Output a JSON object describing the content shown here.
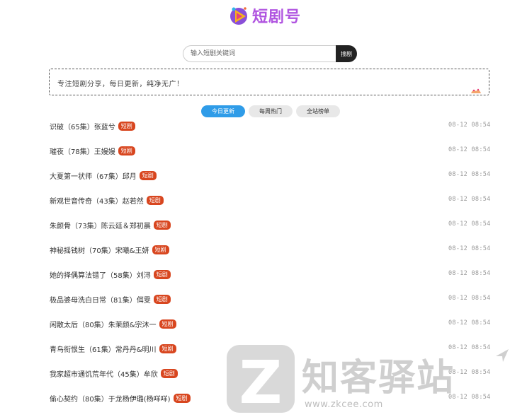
{
  "logo": {
    "text": "短剧号"
  },
  "search": {
    "placeholder": "输入短剧关键词",
    "button_label": "搜剧"
  },
  "notice": {
    "text": "专注短剧分享，每日更新，纯净无广！"
  },
  "tabs": [
    {
      "label": "今日更新",
      "active": true
    },
    {
      "label": "每周热门",
      "active": false
    },
    {
      "label": "全站榜单",
      "active": false
    }
  ],
  "items": [
    {
      "title": "识破（65集）张蓝兮",
      "badge": "短剧",
      "time": "08-12 08:54"
    },
    {
      "title": "璀夜（78集）王嫚嫚",
      "badge": "短剧",
      "time": "08-12 08:54"
    },
    {
      "title": "大夏第一状师（67集）邱月",
      "badge": "短剧",
      "time": "08-12 08:54"
    },
    {
      "title": "新观世音传奇（43集）赵若然",
      "badge": "短剧",
      "time": "08-12 08:54"
    },
    {
      "title": "朱颜骨（73集）陈云廷＆郑初晨",
      "badge": "短剧",
      "time": "08-12 08:54"
    },
    {
      "title": "神秘摇钱树（70集）宋曦&王妍",
      "badge": "短剧",
      "time": "08-12 08:54"
    },
    {
      "title": "她的择偶算法错了（58集）刘浔",
      "badge": "短剧",
      "time": "08-12 08:54"
    },
    {
      "title": "极品婆母洗白日常（81集）佴雯",
      "badge": "短剧",
      "time": "08-12 08:54"
    },
    {
      "title": "闲散太后（80集）朱茉颜&宗沐一",
      "badge": "短剧",
      "time": "08-12 08:54"
    },
    {
      "title": "青鸟衔恨生（61集）常丹丹&明川",
      "badge": "短剧",
      "time": "08-12 08:54"
    },
    {
      "title": "我家超市通饥荒年代（45集）牟欣",
      "badge": "短剧",
      "time": "08-12 08:54"
    },
    {
      "title": "偷心契约（80集）于龙杨伊璐(杨咩咩)",
      "badge": "短剧",
      "time": "08-12 08:54"
    }
  ],
  "watermark": {
    "letter": "Z",
    "title": "知客驿站",
    "url": "www.zkcee.com"
  },
  "colors": {
    "tab_active": "#2f9ce8",
    "badge": "#d8461f",
    "search_button": "#222222",
    "logo_text": "#b054e0"
  }
}
